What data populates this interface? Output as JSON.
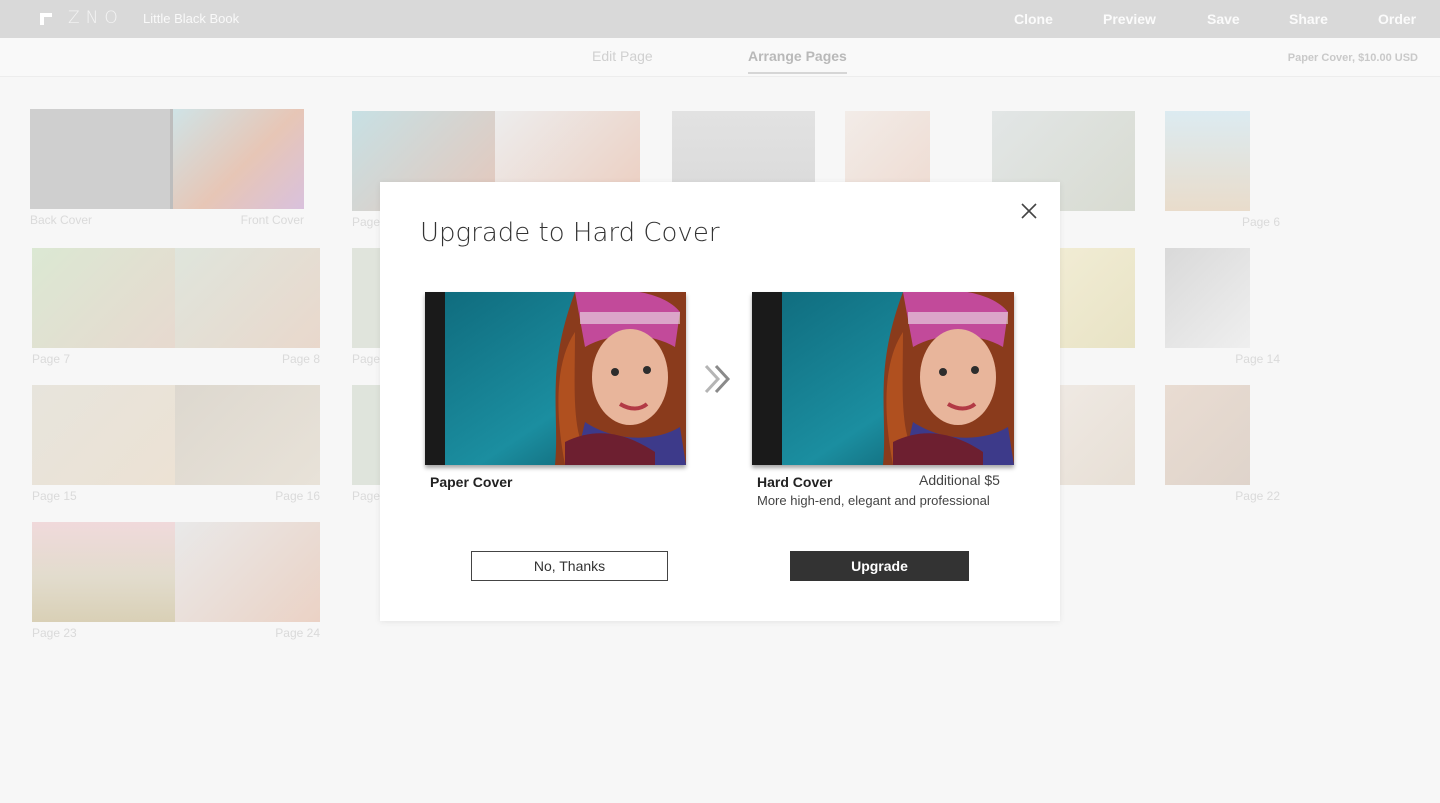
{
  "app": {
    "logo_text": "ZNO",
    "book_title": "Little Black Book"
  },
  "topnav": {
    "clone": "Clone",
    "preview": "Preview",
    "save": "Save",
    "share": "Share",
    "order": "Order"
  },
  "subnav": {
    "edit_page": "Edit Page",
    "arrange_pages": "Arrange Pages",
    "price": "Paper Cover, $10.00 USD"
  },
  "spreads": [
    {
      "left": "Back Cover",
      "right": "Front Cover"
    },
    {
      "left": "Page",
      "right": ""
    },
    {
      "left": "",
      "right": ""
    },
    {
      "left": "",
      "right": "Page 6"
    },
    {
      "left": "Page 7",
      "right": "Page 8"
    },
    {
      "left": "Page",
      "right": ""
    },
    {
      "left": "",
      "right": "Page 14"
    },
    {
      "left": "Page 15",
      "right": "Page 16"
    },
    {
      "left": "Page",
      "right": ""
    },
    {
      "left": "",
      "right": "Page 22"
    },
    {
      "left": "Page 23",
      "right": "Page 24"
    }
  ],
  "modal": {
    "title": "Upgrade to Hard Cover",
    "paper_label": "Paper Cover",
    "hard_label": "Hard Cover",
    "additional": "Additional $5",
    "hard_desc": "More high-end, elegant and professional",
    "no_thanks": "No, Thanks",
    "upgrade": "Upgrade"
  },
  "colors": {
    "topbar": "#d9d9d9",
    "primary_button": "#333333"
  }
}
